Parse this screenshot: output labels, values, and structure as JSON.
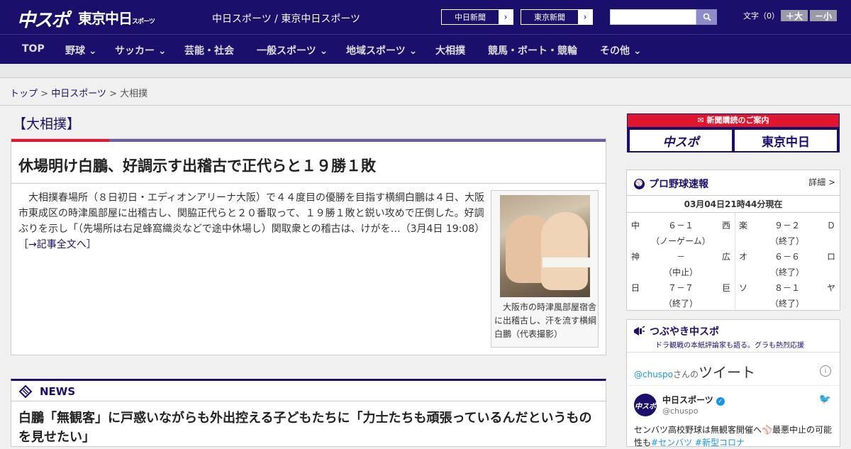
{
  "header": {
    "logo_main": "中スポ",
    "logo_tokyo": "東京中日",
    "logo_tokyo_sub": "スポーツ",
    "site_links": "中日スポーツ / 東京中日スポーツ",
    "chunichi_shimbun": "中日新聞",
    "tokyo_shimbun": "東京新聞",
    "font_label": "文字（0）",
    "font_larger": "＋大",
    "font_smaller": "－小"
  },
  "nav": [
    "TOP",
    "野球",
    "サッカー",
    "芸能・社会",
    "一般スポーツ",
    "地域スポーツ",
    "大相撲",
    "競馬・ボート・競輪",
    "その他"
  ],
  "breadcrumb": {
    "home": "トップ",
    "sep1": " > ",
    "section": "中日スポーツ",
    "sep2": " > ",
    "current": "大相撲"
  },
  "section_title": "【大相撲】",
  "article": {
    "headline": "休場明け白鵬、好調示す出稽古で正代らと１９勝１敗",
    "body": "　大相撲春場所（８日初日・エディオンアリーナ大阪）で４４度目の優勝を目指す横綱白鵬は４日、大阪市東成区の時津風部屋に出稽古し、関脇正代らと２０番取って、１９勝１敗と鋭い攻めで圧倒した。好調ぶりを示し「（先場所は右足蜂窩織炎などで途中休場し）関取衆との稽古は、けがを…（3月4日 19:08）",
    "more": "［→記事全文へ］",
    "caption": "大阪市の時津風部屋宿舎に出稽古し、汗を流す横綱白鵬（代表撮影）"
  },
  "news": {
    "title": "NEWS",
    "headline": "白鵬「無観客」に戸惑いながらも外出控える子どもたちに「力士たちも頑張っているんだというものを見せたい」"
  },
  "ad": {
    "top": "新聞購読のご案内",
    "left": "中スポ",
    "right": "東京中日"
  },
  "baseball": {
    "title": "プロ野球速報",
    "detail": "詳細 >",
    "timestamp": "03月04日21時44分現在",
    "games": [
      {
        "a": "中",
        "score": "６－１",
        "b": "西",
        "status": "（ノーゲーム）"
      },
      {
        "a": "楽",
        "score": "９－２",
        "b": "Ｄ",
        "status": "（終了）"
      },
      {
        "a": "神",
        "score": "－",
        "b": "広",
        "status": "（中止）"
      },
      {
        "a": "オ",
        "score": "６－６",
        "b": "ロ",
        "status": "（終了）"
      },
      {
        "a": "日",
        "score": "７－７",
        "b": "巨",
        "status": "（終了）"
      },
      {
        "a": "ソ",
        "score": "８－１",
        "b": "ヤ",
        "status": "（終了）"
      }
    ]
  },
  "tweets": {
    "title": "つぶやき中スポ",
    "subtitle": "ドラ観戦の本紙評論家も語る。グラも熱烈応援",
    "handle_link": "@chuspo",
    "handle_suffix": "さんの",
    "tweet_label": "ツイート",
    "name": "中日スポーツ",
    "handle": "@chuspo",
    "avatar": "中スポ",
    "text_a": "センバツ高校野球は無観客開催へ",
    "text_b": "最悪中止の可能性も",
    "tag1": "#センバツ",
    "tag2": "#新型コロナ"
  }
}
